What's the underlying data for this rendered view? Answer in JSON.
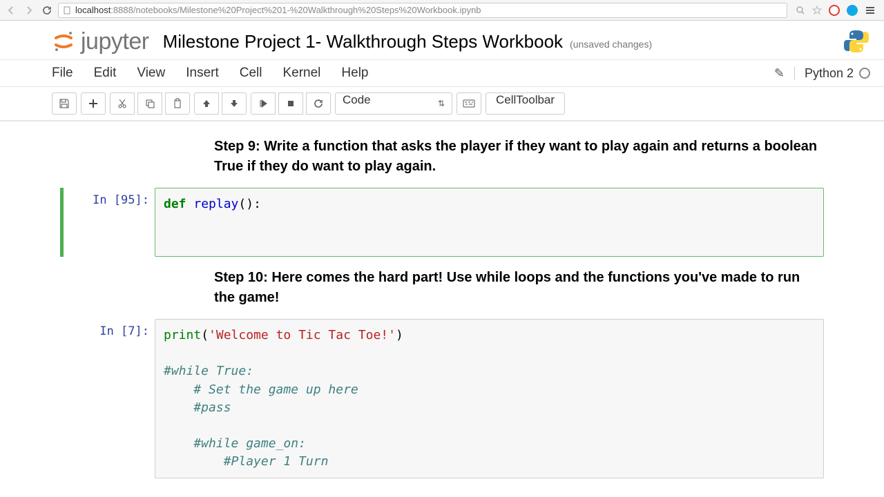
{
  "browser": {
    "url_host": "localhost",
    "url_port": ":8888",
    "url_path": "/notebooks/Milestone%20Project%201-%20Walkthrough%20Steps%20Workbook.ipynb"
  },
  "header": {
    "logo_text": "jupyter",
    "title": "Milestone Project 1- Walkthrough Steps Workbook",
    "save_status": "(unsaved changes)",
    "kernel_name": "Python 2"
  },
  "menu": {
    "file": "File",
    "edit": "Edit",
    "view": "View",
    "insert": "Insert",
    "cell": "Cell",
    "kernel": "Kernel",
    "help": "Help"
  },
  "toolbar": {
    "cell_type": "Code",
    "celltoolbar": "CellToolbar"
  },
  "cells": {
    "step9_html": "Step 9: Write a function that asks the player if they want to play again and returns a boolean True if they do want to play again.",
    "step10_html": "Step 10: Here comes the hard part! Use while loops and the functions you've made to run the game!",
    "cell1_prompt": "In [95]:",
    "cell1_code": {
      "def": "def ",
      "name": "replay",
      "rest": "():",
      "blank1": "    ",
      "blank2": "    "
    },
    "cell2_prompt": "In [7]:",
    "cell2_code": {
      "print": "print",
      "open": "(",
      "str": "'Welcome to Tic Tac Toe!'",
      "close": ")",
      "c1": "#while True:",
      "c2": "    # Set the game up here",
      "c3": "    #pass",
      "c4": "    #while game_on:",
      "c5": "        #Player 1 Turn"
    }
  }
}
